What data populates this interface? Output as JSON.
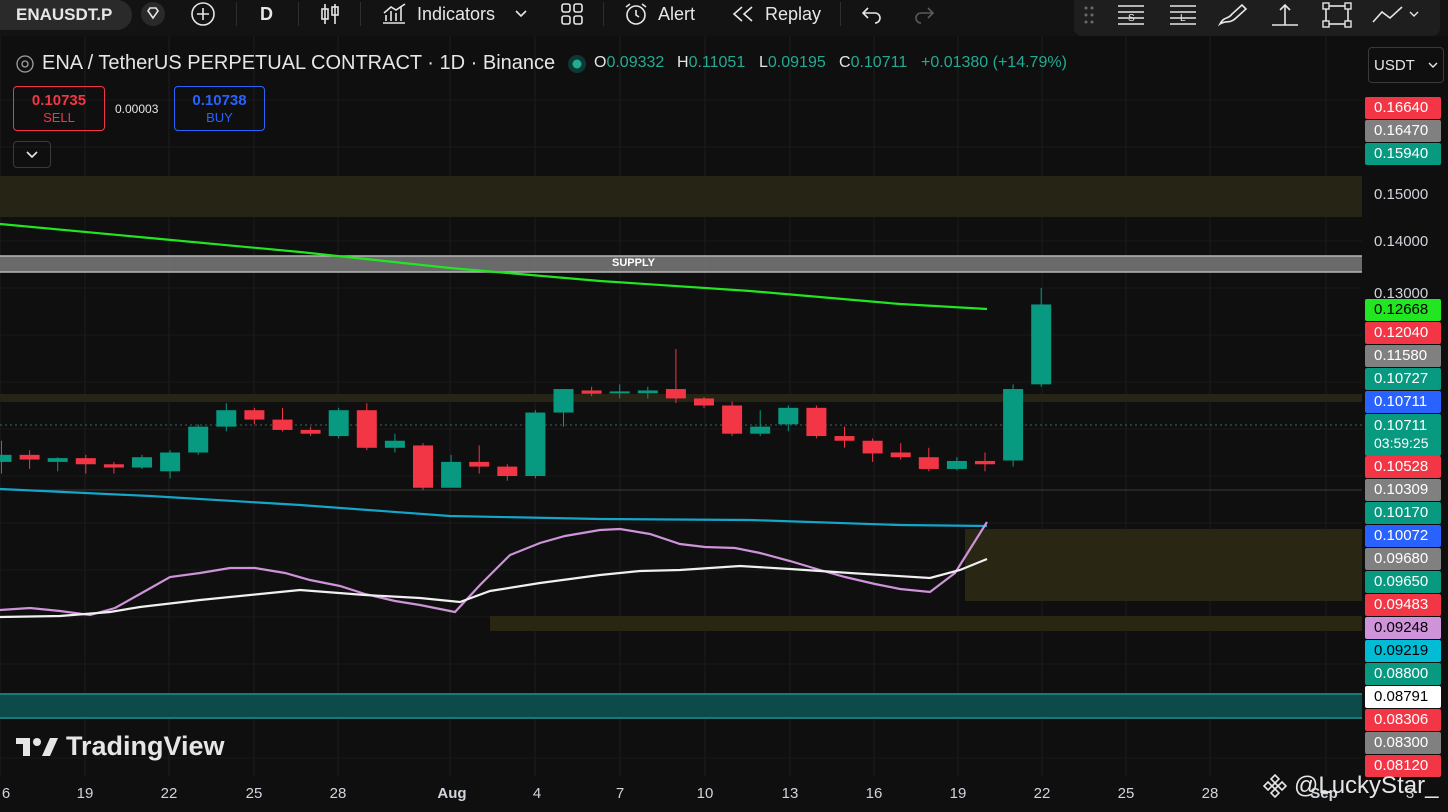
{
  "toolbar": {
    "symbol": "ENAUSDT.P",
    "interval": "D",
    "indicators_label": "Indicators",
    "alert_label": "Alert",
    "replay_label": "Replay"
  },
  "legend": {
    "title": "ENA / TetherUS PERPETUAL CONTRACT · 1D · Binance",
    "open_key": "O",
    "open": "0.09332",
    "high_key": "H",
    "high": "0.11051",
    "low_key": "L",
    "low": "0.09195",
    "close_key": "C",
    "close": "0.10711",
    "change": "+0.01380 (+14.79%)"
  },
  "trade": {
    "sell_price": "0.10735",
    "sell_label": "SELL",
    "spread": "0.00003",
    "buy_price": "0.10738",
    "buy_label": "BUY"
  },
  "currency": "USDT",
  "annotations": {
    "supply_label": "SUPPLY"
  },
  "price_labels": [
    {
      "value": "0.16640",
      "color": "#f23645"
    },
    {
      "value": "0.16470",
      "color": "#808080"
    },
    {
      "value": "0.15940",
      "color": "#089981"
    },
    {
      "value": "0.12668",
      "color": "#22e622"
    },
    {
      "value": "0.12040",
      "color": "#f23645"
    },
    {
      "value": "0.11580",
      "color": "#808080"
    },
    {
      "value": "0.10727",
      "color": "#089981"
    },
    {
      "value": "0.10711",
      "color": "#2962ff"
    },
    {
      "value": "0.10528",
      "color": "#f23645"
    },
    {
      "value": "0.10309",
      "color": "#808080"
    },
    {
      "value": "0.10170",
      "color": "#089981"
    },
    {
      "value": "0.10072",
      "color": "#2962ff"
    },
    {
      "value": "0.09680",
      "color": "#808080"
    },
    {
      "value": "0.09650",
      "color": "#089981"
    },
    {
      "value": "0.09483",
      "color": "#f23645"
    },
    {
      "value": "0.09248",
      "color": "#ce93d8"
    },
    {
      "value": "0.09219",
      "color": "#00bcd4"
    },
    {
      "value": "0.08800",
      "color": "#089981"
    },
    {
      "value": "0.08791",
      "color": "#ffffff"
    },
    {
      "value": "0.08306",
      "color": "#f23645"
    },
    {
      "value": "0.08300",
      "color": "#808080"
    },
    {
      "value": "0.08120",
      "color": "#f23645"
    }
  ],
  "current_price": {
    "value": "0.10711",
    "countdown": "03:59:25",
    "color": "#089981"
  },
  "price_scale": [
    "0.15000",
    "0.14000",
    "0.13000"
  ],
  "time_axis": [
    "6",
    "19",
    "22",
    "25",
    "28",
    "Aug",
    "4",
    "7",
    "10",
    "13",
    "16",
    "19",
    "22",
    "25",
    "28",
    "Sep",
    "3"
  ],
  "branding": {
    "logo_text": "TradingView",
    "watermark": "@LuckyStar_"
  },
  "chart_data": {
    "type": "candlestick",
    "x_start": "Jul 6",
    "y_axis_price_at_ref": [
      0.15,
      0.14
    ],
    "candles": [
      {
        "o": 0.093,
        "h": 0.0975,
        "l": 0.0905,
        "c": 0.0945
      },
      {
        "o": 0.0945,
        "h": 0.0955,
        "l": 0.0915,
        "c": 0.0935
      },
      {
        "o": 0.093,
        "h": 0.094,
        "l": 0.091,
        "c": 0.0938
      },
      {
        "o": 0.0938,
        "h": 0.0945,
        "l": 0.0905,
        "c": 0.0925
      },
      {
        "o": 0.0925,
        "h": 0.093,
        "l": 0.0905,
        "c": 0.0918
      },
      {
        "o": 0.0918,
        "h": 0.0945,
        "l": 0.0915,
        "c": 0.094
      },
      {
        "o": 0.091,
        "h": 0.0955,
        "l": 0.0895,
        "c": 0.095
      },
      {
        "o": 0.095,
        "h": 0.101,
        "l": 0.0945,
        "c": 0.1005
      },
      {
        "o": 0.1005,
        "h": 0.1055,
        "l": 0.0995,
        "c": 0.104
      },
      {
        "o": 0.104,
        "h": 0.1045,
        "l": 0.101,
        "c": 0.102
      },
      {
        "o": 0.102,
        "h": 0.1045,
        "l": 0.0995,
        "c": 0.0998
      },
      {
        "o": 0.0998,
        "h": 0.1005,
        "l": 0.0985,
        "c": 0.099
      },
      {
        "o": 0.0985,
        "h": 0.1045,
        "l": 0.098,
        "c": 0.104
      },
      {
        "o": 0.104,
        "h": 0.1055,
        "l": 0.0955,
        "c": 0.096
      },
      {
        "o": 0.096,
        "h": 0.099,
        "l": 0.095,
        "c": 0.0975
      },
      {
        "o": 0.0965,
        "h": 0.097,
        "l": 0.087,
        "c": 0.0875
      },
      {
        "o": 0.0875,
        "h": 0.0945,
        "l": 0.0875,
        "c": 0.093
      },
      {
        "o": 0.093,
        "h": 0.0965,
        "l": 0.0905,
        "c": 0.092
      },
      {
        "o": 0.092,
        "h": 0.0925,
        "l": 0.089,
        "c": 0.09
      },
      {
        "o": 0.09,
        "h": 0.104,
        "l": 0.0895,
        "c": 0.1035
      },
      {
        "o": 0.1035,
        "h": 0.1085,
        "l": 0.1005,
        "c": 0.1085
      },
      {
        "o": 0.1082,
        "h": 0.109,
        "l": 0.107,
        "c": 0.1075
      },
      {
        "o": 0.1078,
        "h": 0.1095,
        "l": 0.1065,
        "c": 0.108
      },
      {
        "o": 0.1076,
        "h": 0.109,
        "l": 0.1065,
        "c": 0.1082
      },
      {
        "o": 0.1085,
        "h": 0.117,
        "l": 0.1055,
        "c": 0.1065
      },
      {
        "o": 0.1065,
        "h": 0.1068,
        "l": 0.1045,
        "c": 0.105
      },
      {
        "o": 0.105,
        "h": 0.1058,
        "l": 0.0985,
        "c": 0.099
      },
      {
        "o": 0.099,
        "h": 0.104,
        "l": 0.0985,
        "c": 0.1005
      },
      {
        "o": 0.101,
        "h": 0.105,
        "l": 0.0995,
        "c": 0.1045
      },
      {
        "o": 0.1045,
        "h": 0.105,
        "l": 0.098,
        "c": 0.0985
      },
      {
        "o": 0.0985,
        "h": 0.1005,
        "l": 0.096,
        "c": 0.0975
      },
      {
        "o": 0.0975,
        "h": 0.098,
        "l": 0.093,
        "c": 0.0948
      },
      {
        "o": 0.095,
        "h": 0.097,
        "l": 0.0935,
        "c": 0.094
      },
      {
        "o": 0.094,
        "h": 0.096,
        "l": 0.091,
        "c": 0.0915
      },
      {
        "o": 0.0915,
        "h": 0.094,
        "l": 0.0912,
        "c": 0.0932
      },
      {
        "o": 0.0932,
        "h": 0.095,
        "l": 0.091,
        "c": 0.0925
      },
      {
        "o": 0.0933,
        "h": 0.1095,
        "l": 0.092,
        "c": 0.1085
      },
      {
        "o": 0.1095,
        "h": 0.13,
        "l": 0.109,
        "c": 0.1265
      }
    ]
  }
}
